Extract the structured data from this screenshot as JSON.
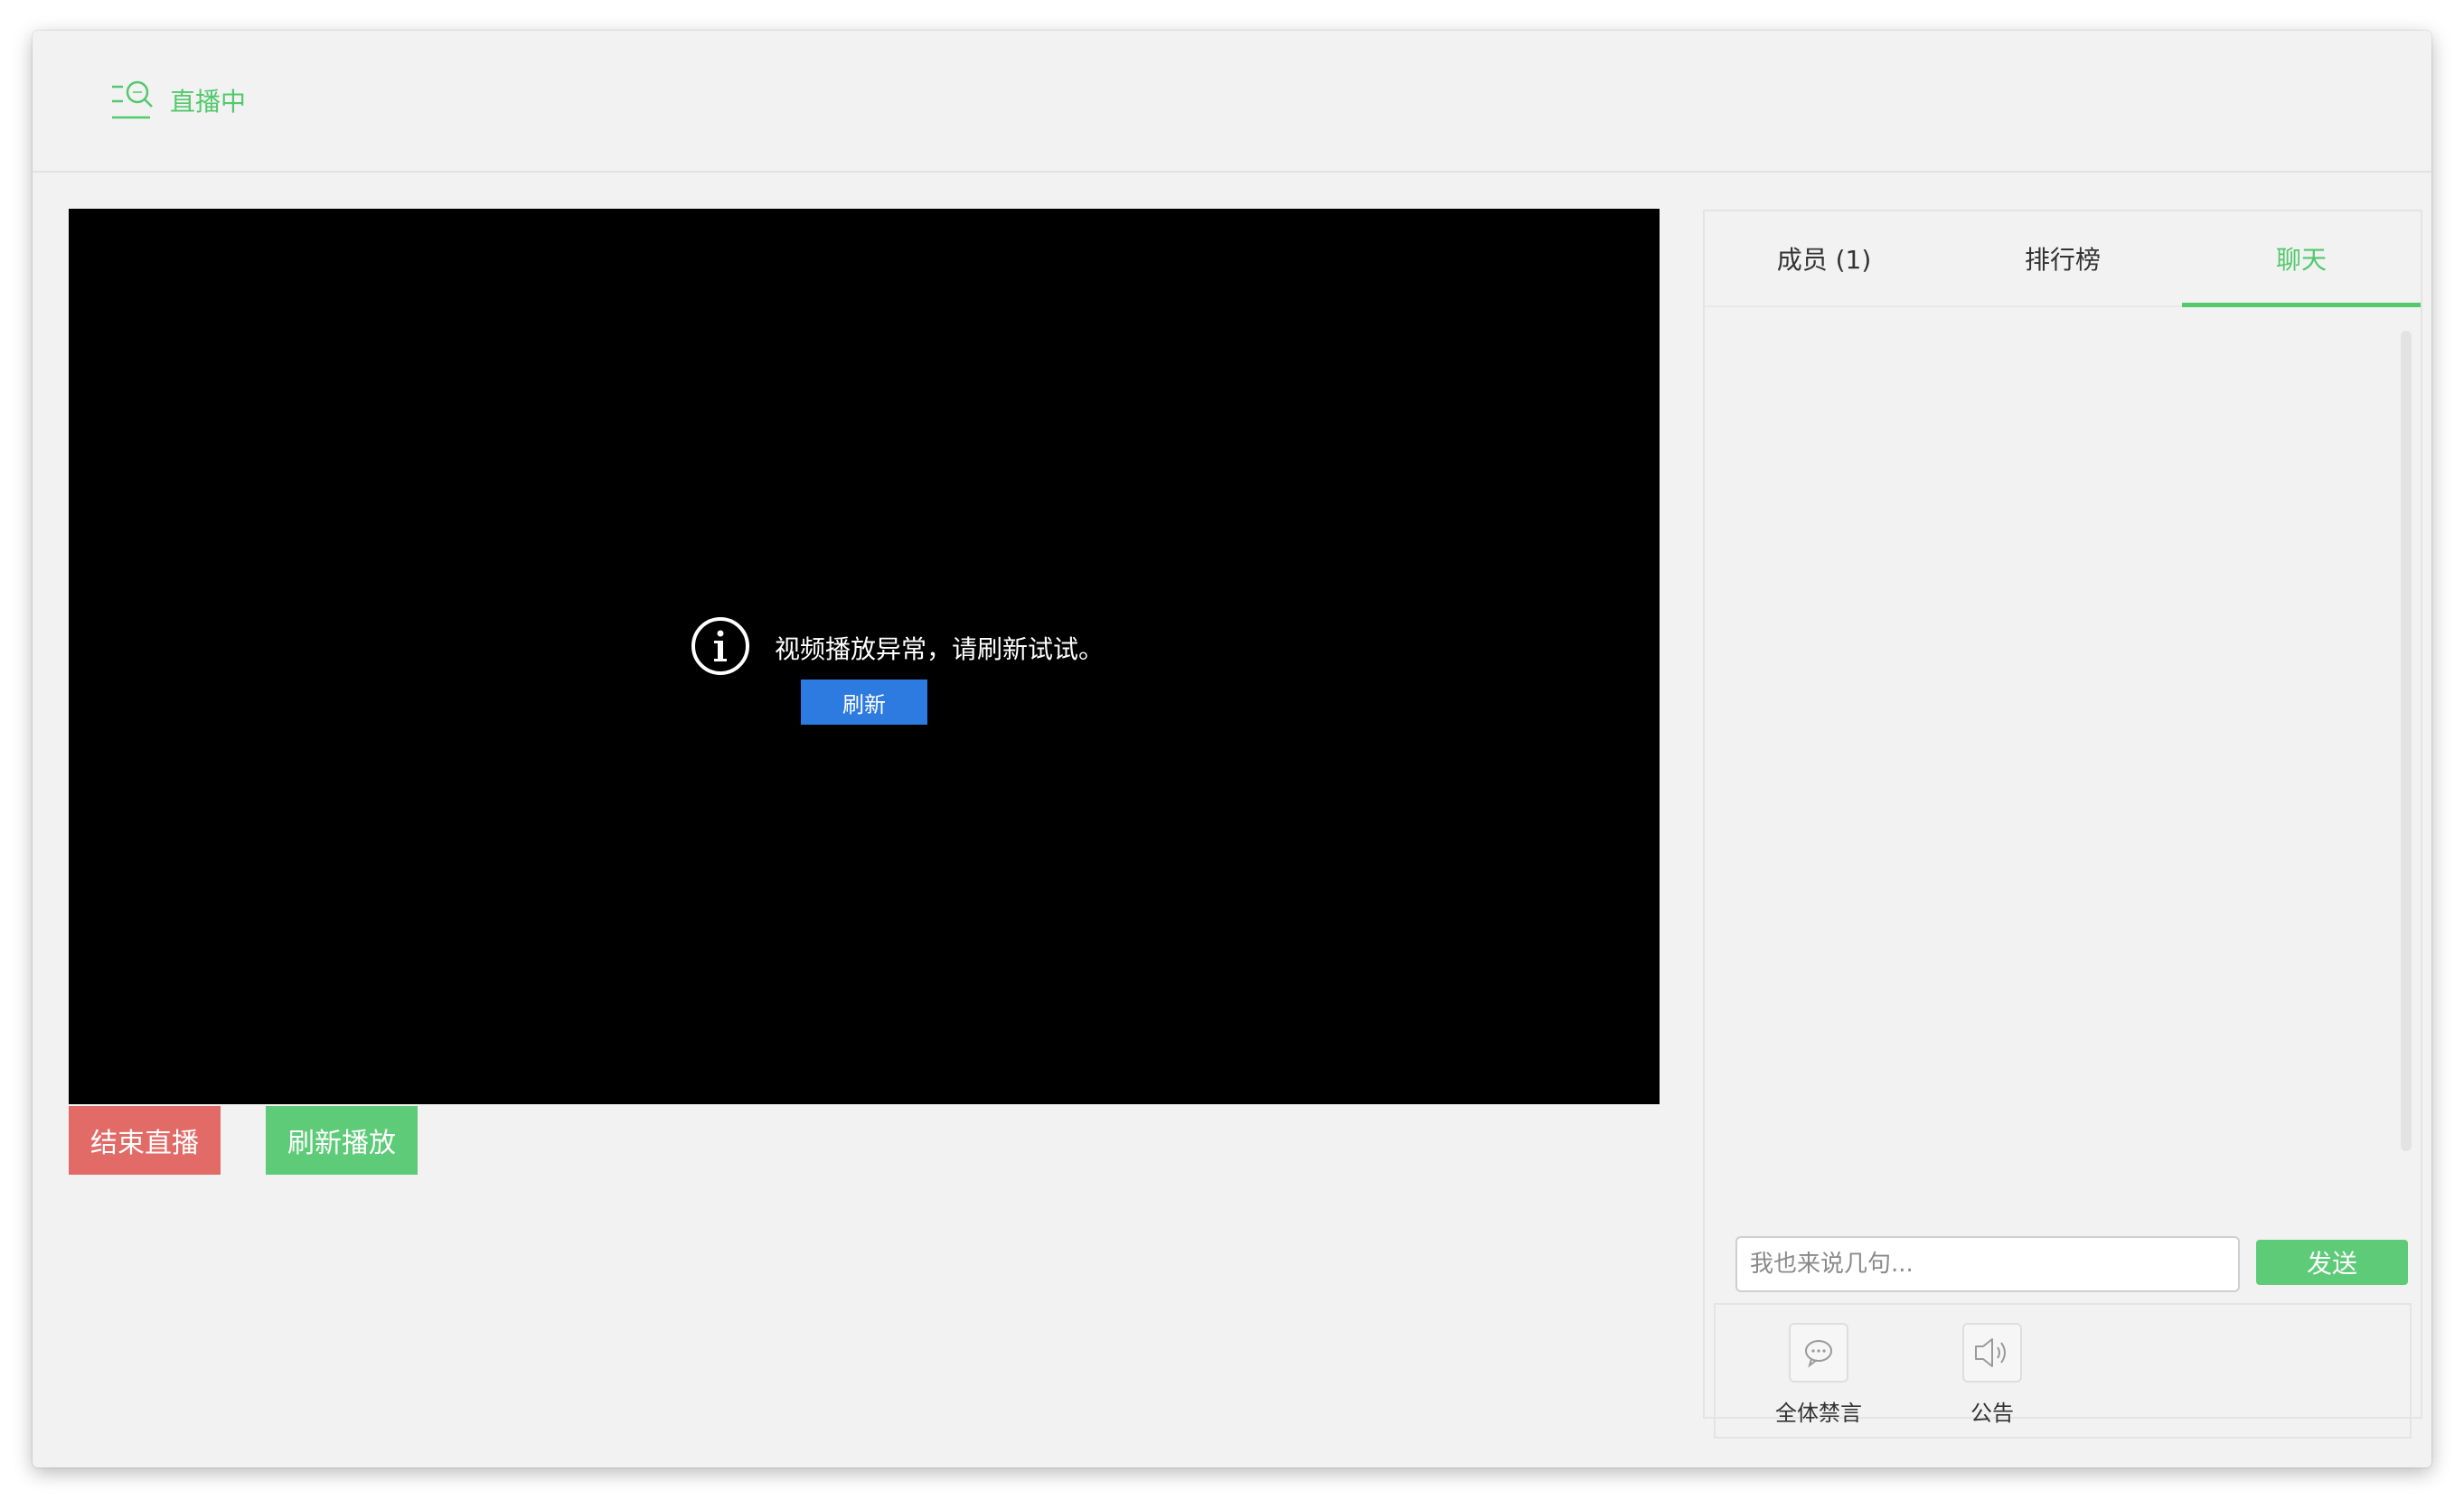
{
  "header": {
    "status_label": "直播中",
    "status_icon": "live-search-icon",
    "accent_color": "#52c96c"
  },
  "video": {
    "error_message": "视频播放异常，请刷新试试。",
    "error_icon": "info-circle-icon",
    "refresh_label": "刷新"
  },
  "actions": {
    "end_live_label": "结束直播",
    "refresh_play_label": "刷新播放"
  },
  "panel": {
    "tabs": [
      {
        "label": "成员 (1)",
        "active": false
      },
      {
        "label": "排行榜",
        "active": false
      },
      {
        "label": "聊天",
        "active": true
      }
    ],
    "chat": {
      "input_placeholder": "我也来说几句...",
      "input_value": "",
      "send_label": "发送"
    },
    "tools": [
      {
        "label": "全体禁言",
        "icon": "chat-bubble-icon"
      },
      {
        "label": "公告",
        "icon": "speaker-icon"
      }
    ]
  },
  "colors": {
    "end_button": "#e26b67",
    "green_button": "#5ecb78",
    "refresh_button": "#2d7ae0",
    "window_bg": "#f2f2f2"
  }
}
